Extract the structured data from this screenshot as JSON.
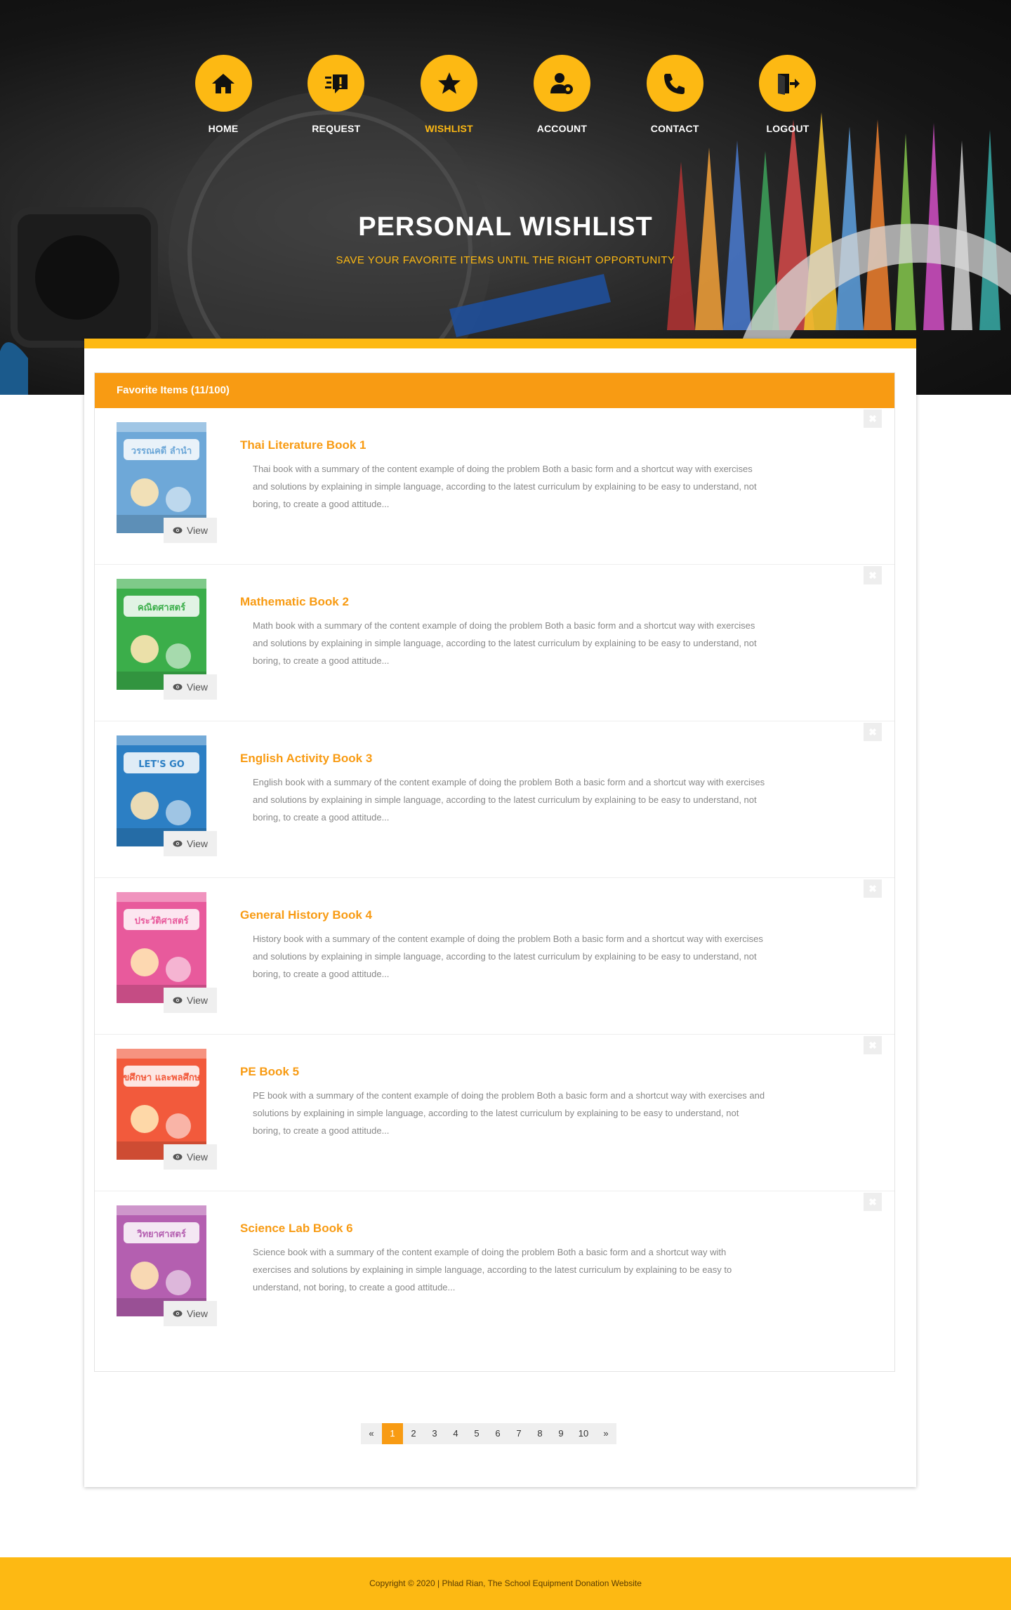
{
  "nav": [
    {
      "label": "HOME",
      "icon": "home-icon"
    },
    {
      "label": "REQUEST",
      "icon": "request-icon"
    },
    {
      "label": "WISHLIST",
      "icon": "star-icon",
      "active": true
    },
    {
      "label": "ACCOUNT",
      "icon": "user-gear-icon"
    },
    {
      "label": "CONTACT",
      "icon": "phone-icon"
    },
    {
      "label": "LOGOUT",
      "icon": "logout-icon"
    }
  ],
  "hero": {
    "title": "PERSONAL WISHLIST",
    "subtitle": "SAVE YOUR FAVORITE ITEMS UNTIL THE RIGHT OPPORTUNITY"
  },
  "panel": {
    "header": "Favorite Items (11/100)",
    "view_label": "View",
    "remove_label": "✖",
    "items": [
      {
        "title": "Thai Literature Book 1",
        "desc": "Thai book with a summary of the content example of doing the problem Both a basic form and a shortcut way with exercises and solutions by explaining in simple language, according to the latest curriculum by explaining to be easy to understand, not boring, to create a good attitude...",
        "cover_text": "วรรณคดี ลำนำ",
        "cover_color": "#6ea8d8"
      },
      {
        "title": "Mathematic Book 2",
        "desc": "Math book with a summary of the content example of doing the problem Both a basic form and a shortcut way with exercises and solutions by explaining in simple language, according to the latest curriculum by explaining to be easy to understand, not boring, to create a good attitude...",
        "cover_text": "คณิตศาสตร์",
        "cover_color": "#3bae4a"
      },
      {
        "title": "English Activity Book 3",
        "desc": "English book with a summary of the content example of doing the problem Both a basic form and a shortcut way with exercises and solutions by explaining in simple language, according to the latest curriculum by explaining to be easy to understand, not boring, to create a good attitude...",
        "cover_text": "LET'S GO",
        "cover_color": "#2c7fc4"
      },
      {
        "title": "General History Book 4",
        "desc": "History book with a summary of the content example of doing the problem Both a basic form and a shortcut way with exercises and solutions by explaining in simple language, according to the latest curriculum by explaining to be easy to understand, not boring, to create a good attitude...",
        "cover_text": "ประวัติศาสตร์",
        "cover_color": "#e85a9c"
      },
      {
        "title": "PE Book 5",
        "desc": "PE book with a summary of the content example of doing the problem Both a basic form and a shortcut way with exercises and solutions by explaining in simple language, according to the latest curriculum by explaining to be easy to understand, not boring, to create a good attitude...",
        "cover_text": "สุขศึกษา และพลศึกษา",
        "cover_color": "#f25a3c"
      },
      {
        "title": "Science Lab Book 6",
        "desc": "Science book with a summary of the content example of doing the problem Both a basic form and a shortcut way with exercises and solutions by explaining in simple language, according to the latest curriculum by explaining to be easy to understand, not boring, to create a good attitude...",
        "cover_text": "วิทยาศาสตร์",
        "cover_color": "#b45fb0"
      }
    ]
  },
  "pagination": {
    "prev": "«",
    "next": "»",
    "pages": [
      "1",
      "2",
      "3",
      "4",
      "5",
      "6",
      "7",
      "8",
      "9",
      "10"
    ],
    "current": "1"
  },
  "footer": {
    "text": "Copyright © 2020 | Phlad Rian, The School Equipment Donation Website"
  },
  "colors": {
    "accent": "#fdb913",
    "orange": "#f89b13"
  }
}
